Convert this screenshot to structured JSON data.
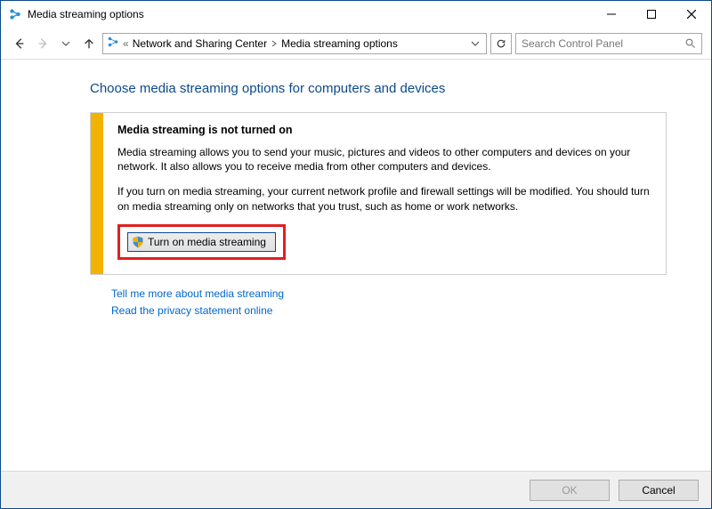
{
  "window": {
    "title": "Media streaming options"
  },
  "breadcrumb": {
    "prefix": "«",
    "items": [
      "Network and Sharing Center",
      "Media streaming options"
    ]
  },
  "search": {
    "placeholder": "Search Control Panel"
  },
  "content": {
    "heading": "Choose media streaming options for computers and devices",
    "card": {
      "title": "Media streaming is not turned on",
      "para1": "Media streaming allows you to send your music, pictures and videos to other computers and devices on your network.  It also allows you to receive media from other computers and devices.",
      "para2": "If you turn on media streaming, your current network profile and firewall settings will be modified. You should turn on media streaming only on networks that you trust, such as home or work networks.",
      "button_label": "Turn on media streaming"
    },
    "links": {
      "more": "Tell me more about media streaming",
      "privacy": "Read the privacy statement online"
    }
  },
  "footer": {
    "ok": "OK",
    "cancel": "Cancel"
  }
}
